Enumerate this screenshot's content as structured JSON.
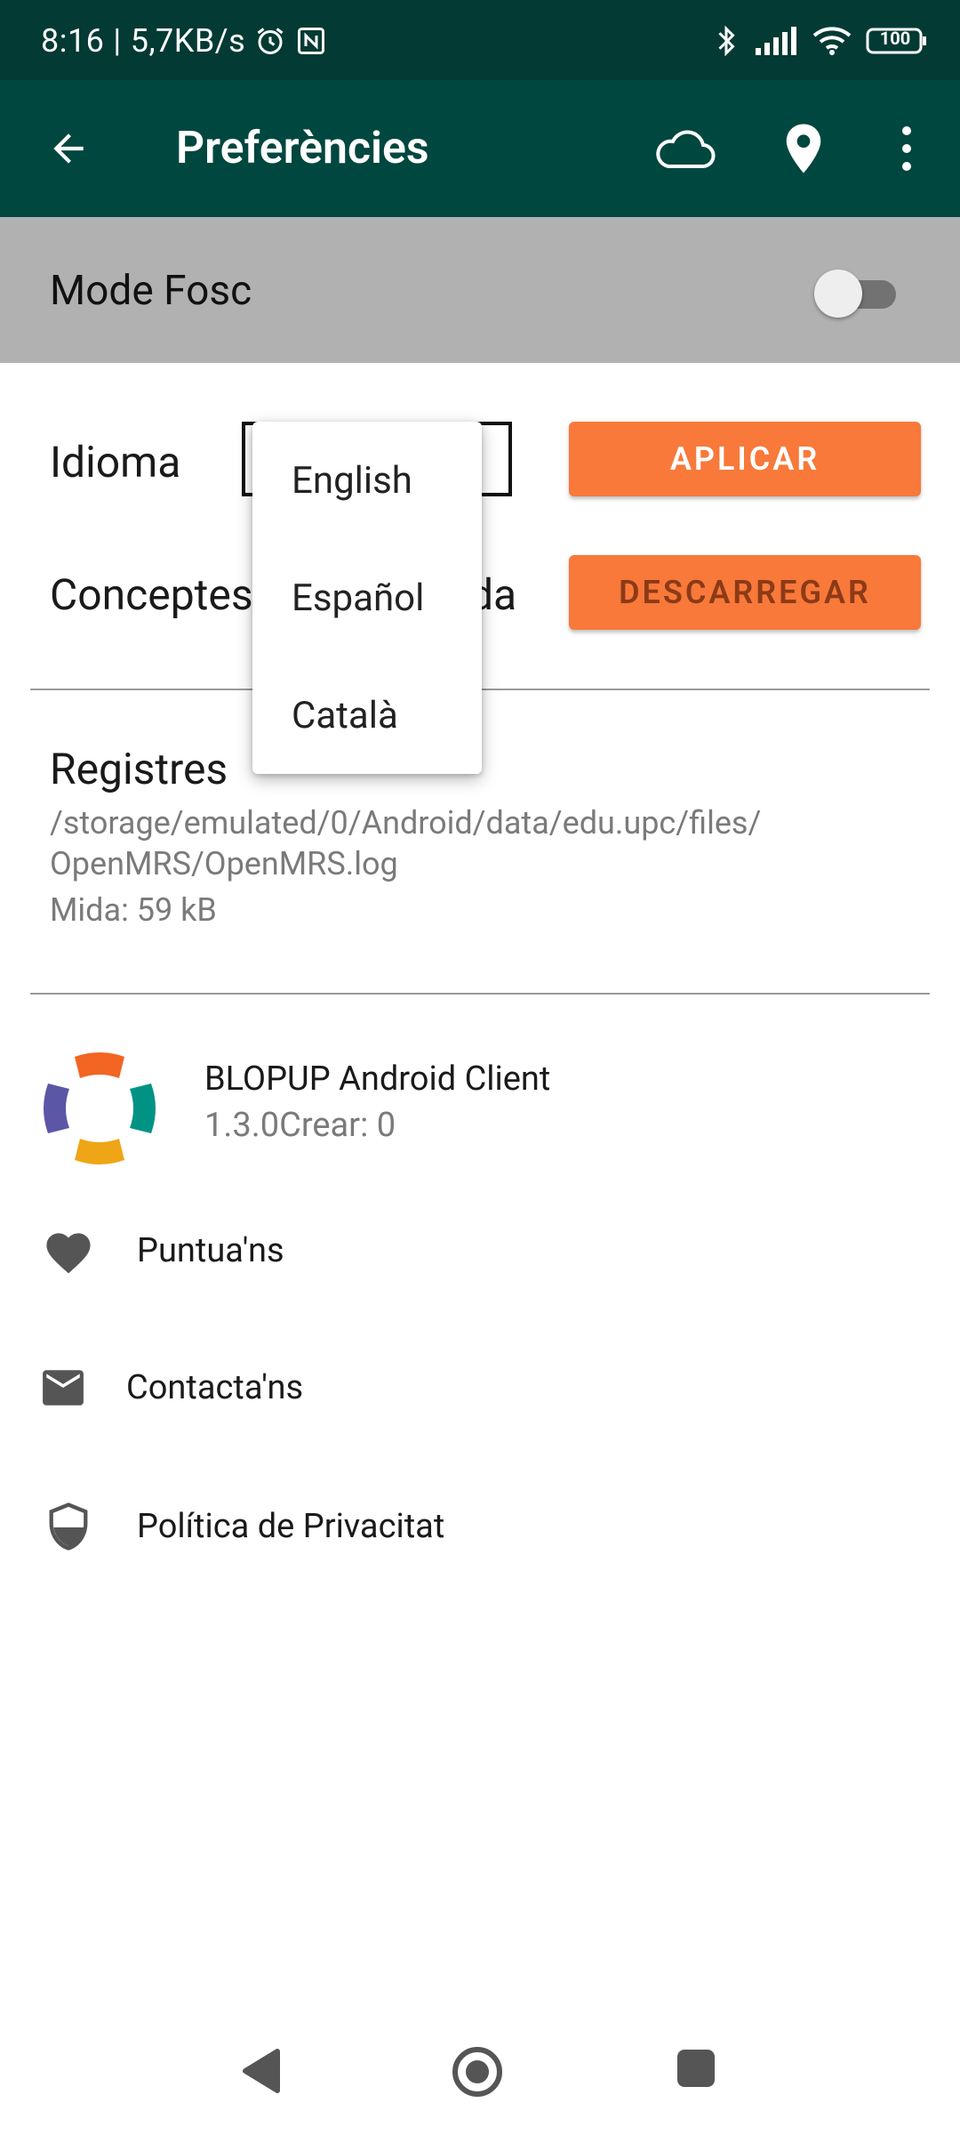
{
  "status_bar": {
    "time": "8:16",
    "separator": "|",
    "net_speed": "5,7KB/s",
    "battery": "100"
  },
  "toolbar": {
    "title": "Preferències"
  },
  "dark_mode": {
    "label": "Mode Fosc",
    "enabled": false
  },
  "language": {
    "label": "Idioma",
    "apply_label": "APLICAR",
    "options": [
      "English",
      "Español",
      "Català"
    ]
  },
  "concepts": {
    "label_visible_left": "Conceptes",
    "label_visible_right": "e da",
    "download_label": "DESCARREGAR"
  },
  "logs": {
    "title": "Registres",
    "path_line1": "/storage/emulated/0/Android/data/edu.upc/files/",
    "path_line2": "OpenMRS/OpenMRS.log",
    "size": "Mida: 59 kB"
  },
  "app_info": {
    "name": "BLOPUP Android Client",
    "version": "1.3.0Crear: 0"
  },
  "menu": {
    "rate": "Puntua'ns",
    "contact": "Contacta'ns",
    "privacy": "Política de Privacitat"
  },
  "colors": {
    "status_bar": "#033a33",
    "toolbar": "#00473f",
    "accent_orange": "#f8793a",
    "darkmode_row": "#b1b1b1"
  }
}
